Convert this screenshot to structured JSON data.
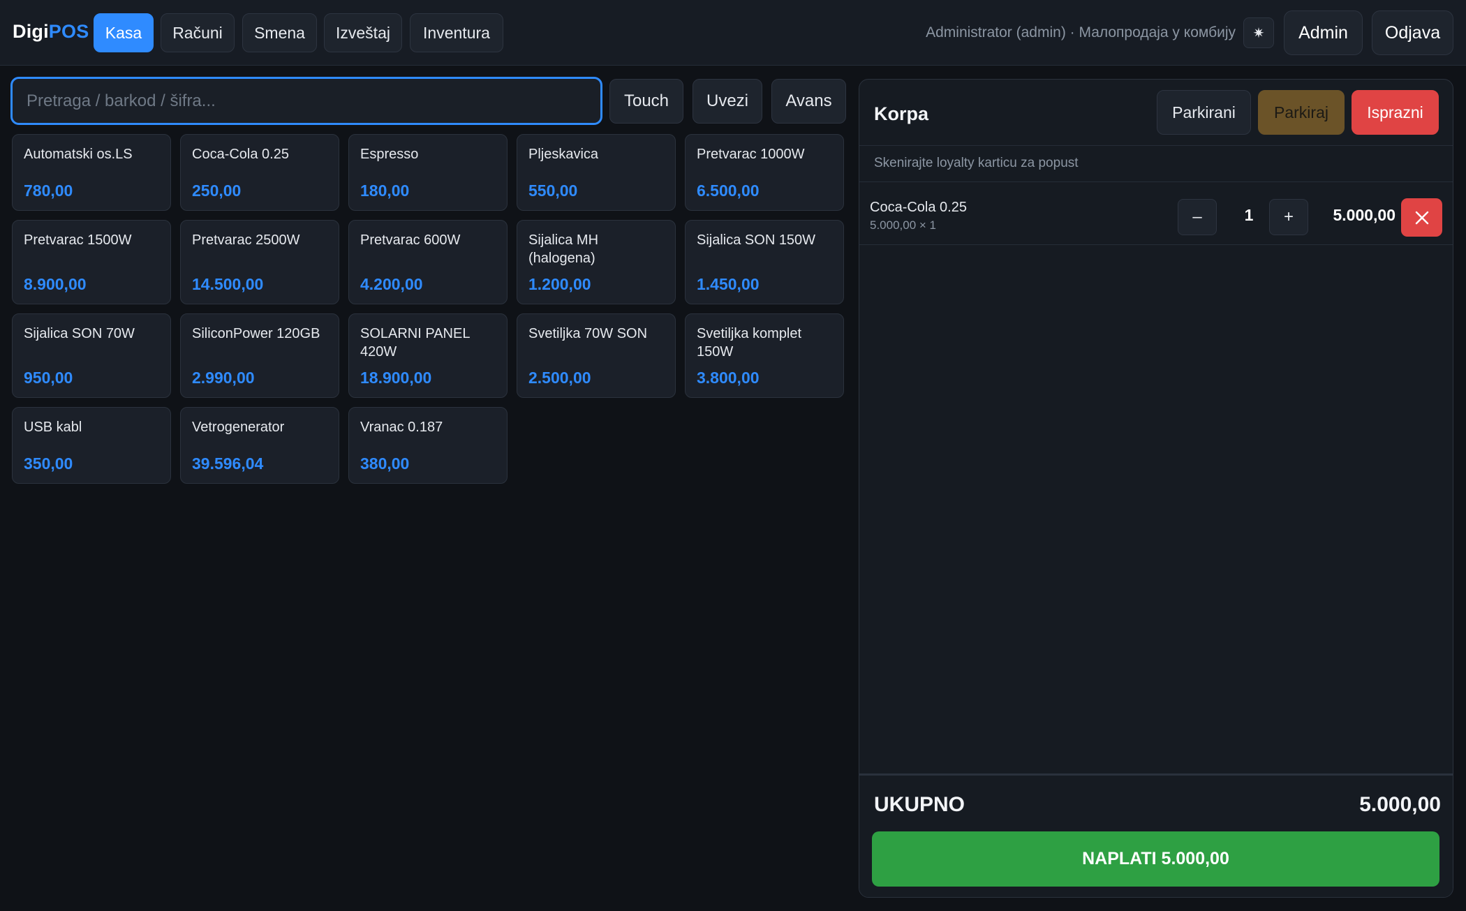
{
  "header": {
    "brand_main": "Digi",
    "brand_accent": "POS",
    "nav": [
      "Kasa",
      "Računi",
      "Smena",
      "Izveštaj",
      "Inventura"
    ],
    "active_nav": "Kasa",
    "user_info": "Administrator (admin) · Малопродаја у комбију",
    "theme_icon": "✷",
    "admin_label": "Admin",
    "logout_label": "Odjava"
  },
  "search": {
    "placeholder": "Pretraga / barkod / šifra...",
    "value": ""
  },
  "actions": {
    "touch": "Touch",
    "import": "Uvezi",
    "advance": "Avans"
  },
  "products": [
    {
      "name": "Automatski os.LS",
      "price": "780,00"
    },
    {
      "name": "Coca-Cola 0.25",
      "price": "250,00"
    },
    {
      "name": "Espresso",
      "price": "180,00"
    },
    {
      "name": "Pljeskavica",
      "price": "550,00"
    },
    {
      "name": "Pretvarac 1000W",
      "price": "6.500,00"
    },
    {
      "name": "Pretvarac 1500W",
      "price": "8.900,00"
    },
    {
      "name": "Pretvarac 2500W",
      "price": "14.500,00"
    },
    {
      "name": "Pretvarac 600W",
      "price": "4.200,00"
    },
    {
      "name": "Sijalica MH (halogena)",
      "price": "1.200,00"
    },
    {
      "name": "Sijalica SON 150W",
      "price": "1.450,00"
    },
    {
      "name": "Sijalica SON 70W",
      "price": "950,00"
    },
    {
      "name": "SiliconPower 120GB",
      "price": "2.990,00"
    },
    {
      "name": "SOLARNI PANEL 420W",
      "price": "18.900,00"
    },
    {
      "name": "Svetiljka 70W SON",
      "price": "2.500,00"
    },
    {
      "name": "Svetiljka komplet 150W",
      "price": "3.800,00"
    },
    {
      "name": "USB kabl",
      "price": "350,00"
    },
    {
      "name": "Vetrogenerator",
      "price": "39.596,04"
    },
    {
      "name": "Vranac 0.187",
      "price": "380,00"
    }
  ],
  "cart": {
    "title": "Korpa",
    "parked_label": "Parkirani",
    "park_label": "Parkiraj",
    "clear_label": "Isprazni",
    "loyalty_hint": "Skenirajte loyalty karticu za popust",
    "items": [
      {
        "name": "Coca-Cola 0.25",
        "unit_line": "5.000,00 × 1",
        "qty": "1",
        "minus": "–",
        "plus": "+",
        "total": "5.000,00"
      }
    ],
    "total_label": "UKUPNO",
    "total_value": "5.000,00",
    "pay_label": "NAPLATI 5.000,00"
  },
  "colors": {
    "accent": "#2f8bff",
    "danger": "#e04444",
    "success": "#2ea043",
    "park": "#6b5328",
    "background": "#0f1217"
  }
}
